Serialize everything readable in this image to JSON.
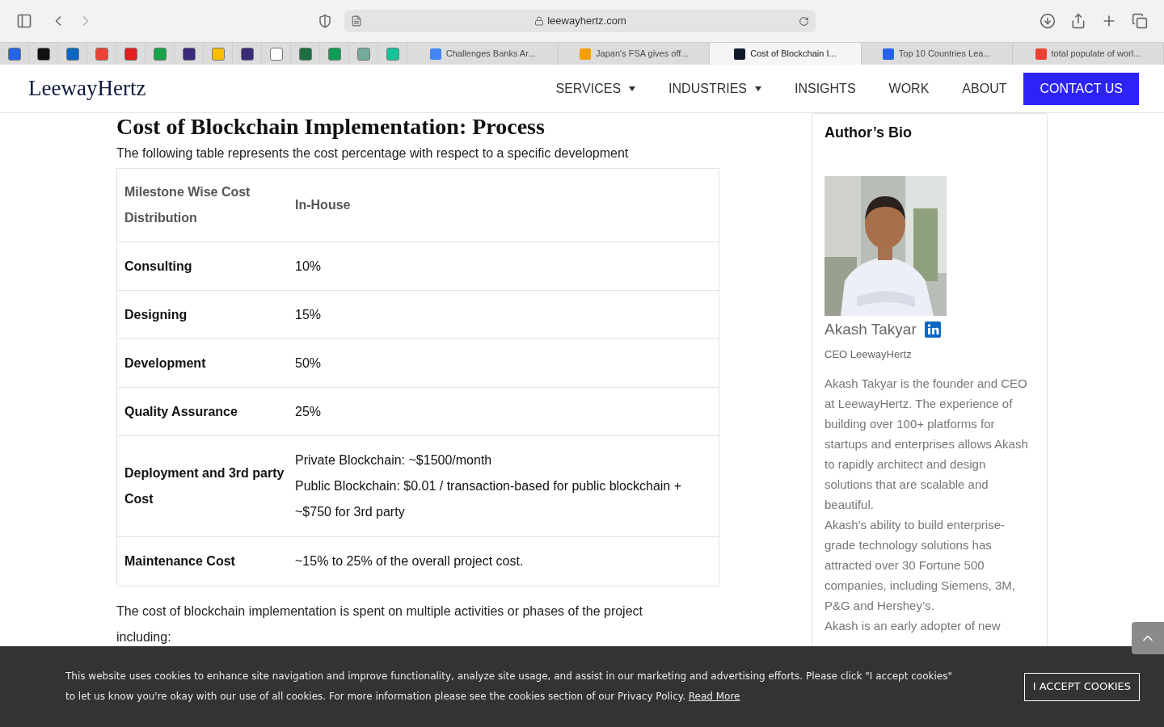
{
  "browser": {
    "url": "leewayhertz.com"
  },
  "bookmarks": [
    {
      "color": "#2563eb"
    },
    {
      "color": "#111111"
    },
    {
      "color": "#0a66c2"
    },
    {
      "color": "#ea4335"
    },
    {
      "color": "#e11d1d"
    },
    {
      "color": "#16a34a"
    },
    {
      "color": "#3b2a7a"
    },
    {
      "color": "#fbbc04"
    },
    {
      "color": "#3b2a7a"
    },
    {
      "color": "#ffffff"
    },
    {
      "color": "#1d6f42"
    },
    {
      "color": "#0f9d58"
    },
    {
      "color": "#74aa9c"
    },
    {
      "color": "#15c39a"
    }
  ],
  "tabs": [
    {
      "title": "Challenges Banks Ar...",
      "selected": false,
      "color": "#4285f4"
    },
    {
      "title": "Japan's FSA gives off...",
      "selected": false,
      "color": "#f59e0b"
    },
    {
      "title": "Cost of Blockchain I...",
      "selected": true,
      "color": "#0f1b2d"
    },
    {
      "title": "Top 10 Countries Lea...",
      "selected": false,
      "color": "#2563eb"
    },
    {
      "title": "total populate of worl...",
      "selected": false,
      "color": "#ea4335"
    }
  ],
  "site": {
    "logo": "LeewayHertz",
    "nav": [
      {
        "label": "SERVICES",
        "dropdown": true
      },
      {
        "label": "INDUSTRIES",
        "dropdown": true
      },
      {
        "label": "INSIGHTS",
        "dropdown": false
      },
      {
        "label": "WORK",
        "dropdown": false
      },
      {
        "label": "ABOUT",
        "dropdown": false
      }
    ],
    "cta": "CONTACT US"
  },
  "article": {
    "heading": "Cost of Blockchain Implementation: Process",
    "intro": "The following table represents the cost percentage with respect to a specific development",
    "table": {
      "columns": [
        "Milestone Wise Cost Distribution",
        "In-House"
      ],
      "rows": [
        {
          "milestone": "Consulting",
          "cost": [
            "10%"
          ]
        },
        {
          "milestone": "Designing",
          "cost": [
            "15%"
          ]
        },
        {
          "milestone": "Development",
          "cost": [
            "50%"
          ]
        },
        {
          "milestone": "Quality Assurance",
          "cost": [
            "25%"
          ]
        },
        {
          "milestone": "Deployment and 3rd party Cost",
          "cost": [
            "Private Blockchain: ~$1500/month",
            "Public Blockchain: $0.01 / transaction-based for public blockchain + ~$750 for 3rd party"
          ]
        },
        {
          "milestone": "Maintenance Cost",
          "cost": [
            "~15% to 25% of the overall project cost."
          ]
        }
      ]
    },
    "after": "The cost of blockchain implementation is spent on multiple activities or phases of the project including:"
  },
  "author": {
    "title": "Author’s Bio",
    "name": "Akash Takyar",
    "role": "CEO LeewayHertz",
    "bio": [
      "Akash Takyar is the founder and CEO at LeewayHertz. The experience of building over 100+ platforms for startups and enterprises allows Akash to rapidly architect and design solutions that are scalable and beautiful.",
      "Akash's ability to build enterprise-grade technology solutions has attracted over 30 Fortune 500 companies, including Siemens, 3M, P&G and Hershey’s.",
      "Akash is an early adopter of new"
    ]
  },
  "cookie_banner": {
    "text": "This website uses cookies to enhance site navigation and improve functionality, analyze site usage, and assist in our marketing and advertising efforts. Please click \"I accept cookies\" to let us know you're okay with our use of all cookies. For more information please see the cookies section of our Privacy Policy.",
    "link": "Read More",
    "button": "I ACCEPT COOKIES"
  }
}
